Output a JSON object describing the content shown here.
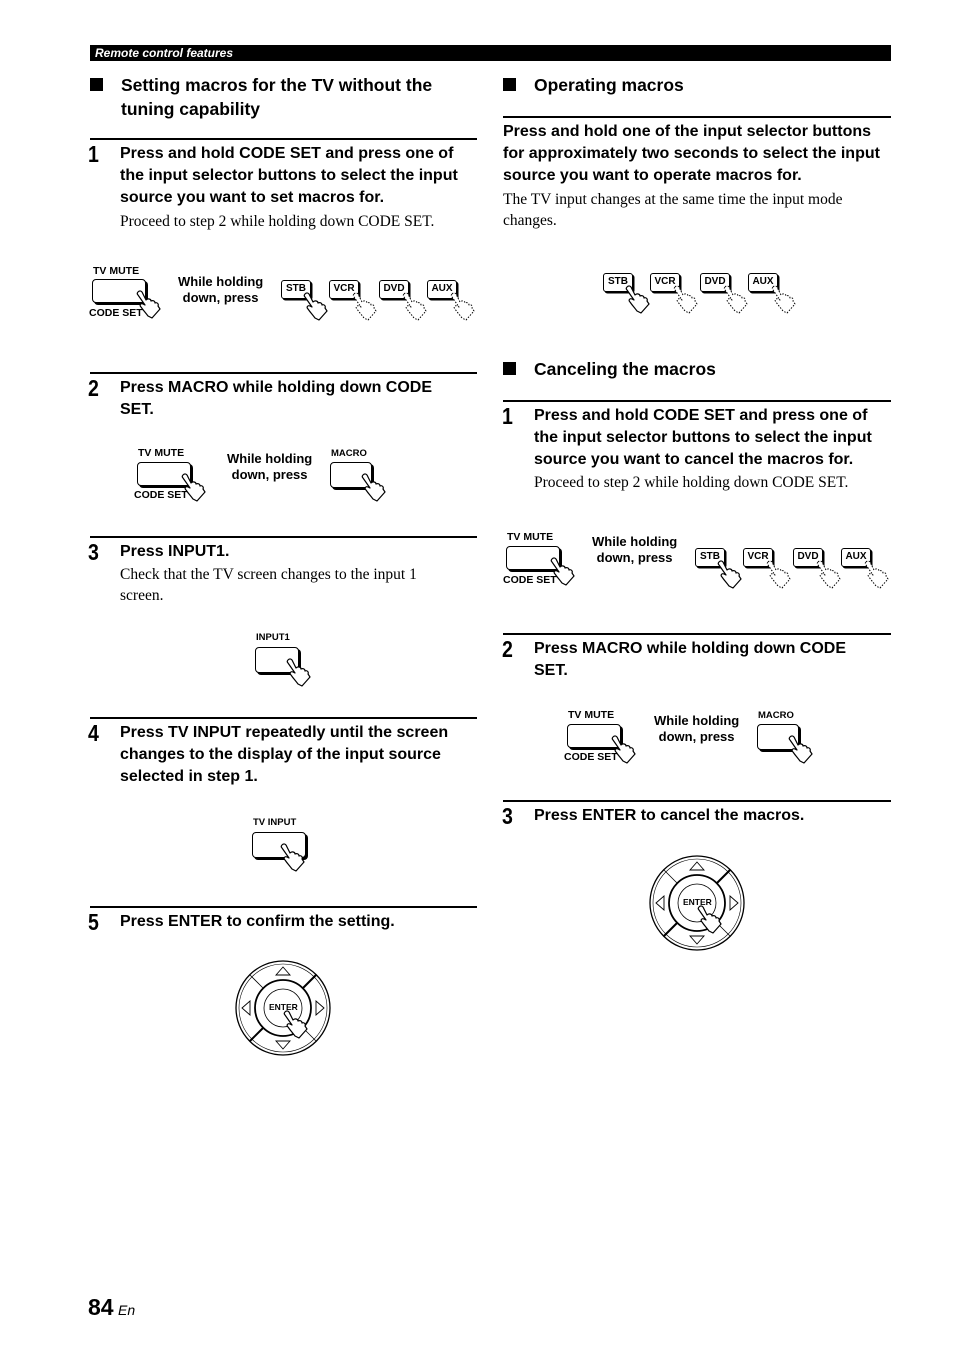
{
  "header": {
    "section": "Remote control features"
  },
  "left": {
    "title": "Setting macros for the TV without the tuning capability",
    "title_line1": "Setting macros for the TV without the",
    "title_line2": "tuning capability",
    "steps": [
      {
        "num": "1",
        "lines": [
          "Press and hold CODE SET and press one of",
          "the input selector buttons to select the input",
          "source you want to set macros for."
        ],
        "note": "Proceed to step 2 while holding down CODE SET."
      },
      {
        "num": "2",
        "lines": [
          "Press MACRO while holding down CODE",
          "SET."
        ]
      },
      {
        "num": "3",
        "lines": [
          "Press INPUT1."
        ],
        "note_lines": [
          "Check that the TV screen changes to the input 1",
          "screen."
        ]
      },
      {
        "num": "4",
        "lines": [
          "Press TV INPUT repeatedly until the screen",
          "changes to the display of the input source",
          "selected in step 1."
        ]
      },
      {
        "num": "5",
        "lines": [
          "Press ENTER to confirm the setting."
        ]
      }
    ]
  },
  "right": {
    "operating": {
      "title": "Operating macros",
      "lines": [
        "Press and hold one of the input selector buttons",
        "for approximately two seconds to select the input",
        "source you want to operate macros for."
      ],
      "note_lines": [
        "The TV input changes at the same time the input mode",
        "changes."
      ]
    },
    "canceling": {
      "title": "Canceling the macros",
      "steps": [
        {
          "num": "1",
          "lines": [
            "Press and hold CODE SET and press one of",
            "the input selector buttons to select the input",
            "source you want to cancel the macros for."
          ],
          "note": "Proceed to step 2 while holding down CODE SET."
        },
        {
          "num": "2",
          "lines": [
            "Press MACRO while holding down CODE",
            "SET."
          ]
        },
        {
          "num": "3",
          "lines": [
            "Press ENTER to cancel the macros."
          ]
        }
      ]
    }
  },
  "remote": {
    "tv_mute": "TV MUTE",
    "code_set": "CODE SET",
    "while_line1": "While holding",
    "while_line2": "down, press",
    "macro": "MACRO",
    "input1": "INPUT1",
    "tv_input": "TV INPUT",
    "enter": "ENTER",
    "selectors": [
      "STB",
      "VCR",
      "DVD",
      "AUX"
    ]
  },
  "footer": {
    "page": "84",
    "lang": "En"
  }
}
